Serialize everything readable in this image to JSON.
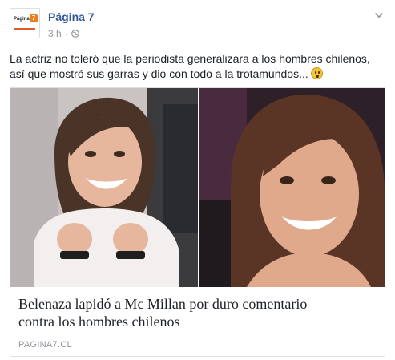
{
  "page": {
    "name": "Página 7",
    "avatar_text": "Página",
    "avatar_badge": "7",
    "timestamp": "3 h",
    "separator": "·",
    "audience_icon": "globe-icon",
    "menu_icon": "chevron-down-icon"
  },
  "post": {
    "caption_line1": "La actriz no toleró que la periodista generalizara a los hombres chilenos,",
    "caption_line2": "así que mostró sus garras y dio con todo a la trotamundos...",
    "caption_emoji": "surprised-face-emoji"
  },
  "link": {
    "headline_line1": "Belenaza lapidó a Mc Millan por duro comentario",
    "headline_line2": "contra los hombres chilenos",
    "domain": "PAGINA7.CL"
  },
  "colors": {
    "link_blue": "#365899",
    "meta_gray": "#90949c",
    "text": "#1d2129",
    "border": "#dddfe2"
  }
}
